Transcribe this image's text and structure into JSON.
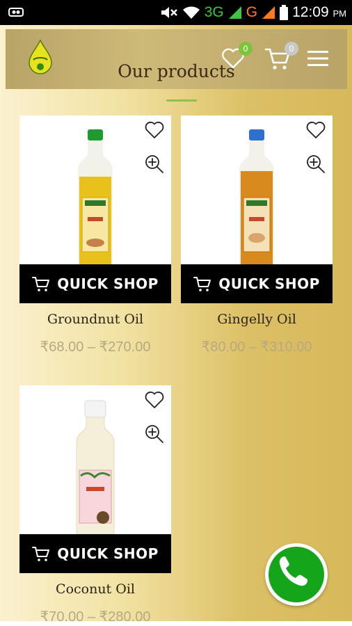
{
  "status_bar": {
    "network_3g": "3G",
    "network_g": "G",
    "time": "12:09",
    "ampm": "PM"
  },
  "header": {
    "title": "Our products",
    "wishlist_count": "0",
    "cart_count": "0",
    "accent": "#8fc24a"
  },
  "products": [
    {
      "name": "Groundnut Oil",
      "price": "₹68.00 – ₹270.00",
      "quick_shop": "QUICK SHOP",
      "cap_color": "#1f9a2e",
      "oil_color": "#e8c21a"
    },
    {
      "name": "Gingelly Oil",
      "price": "₹80.00 – ₹310.00",
      "quick_shop": "QUICK SHOP",
      "cap_color": "#2f6fd0",
      "oil_color": "#d98a1c"
    },
    {
      "name": "Coconut Oil",
      "price": "₹70.00 – ₹280.00",
      "quick_shop": "QUICK SHOP",
      "cap_color": "#f2f2f2",
      "oil_color": "#f4efd8"
    }
  ],
  "fab": {
    "icon": "phone-icon",
    "color": "#14a51a"
  }
}
